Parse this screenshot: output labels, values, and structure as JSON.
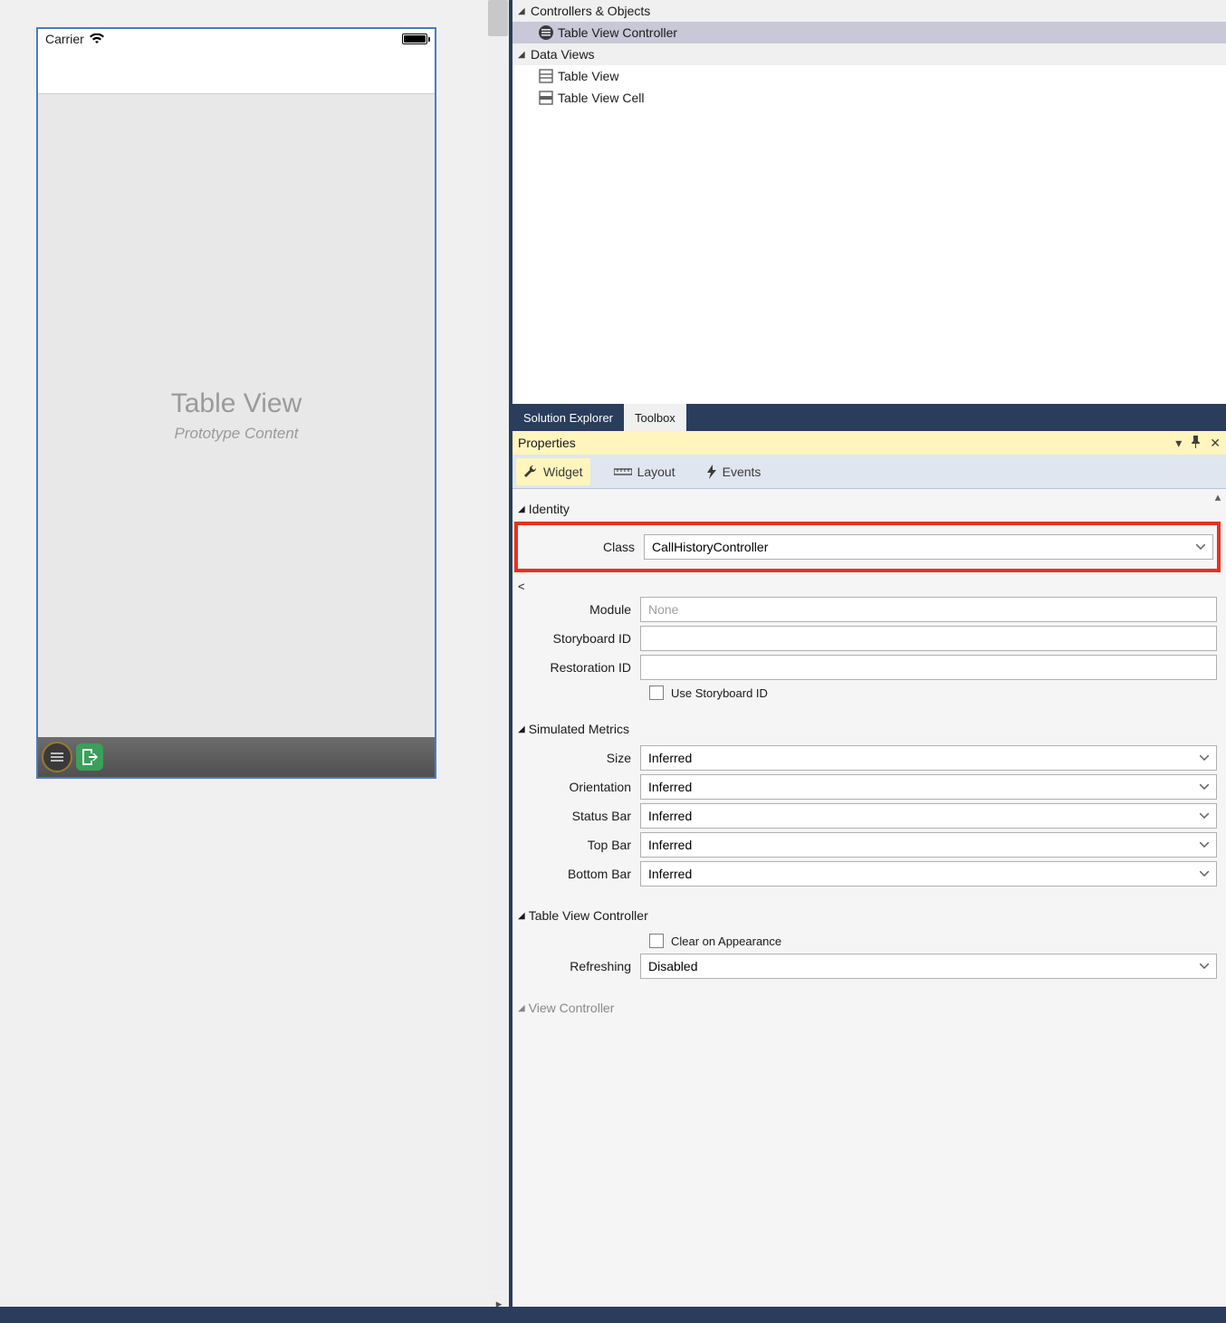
{
  "designer": {
    "carrier": "Carrier",
    "table_title": "Table View",
    "table_sub": "Prototype Content"
  },
  "outline": {
    "section1": "Controllers & Objects",
    "item1": "Table View Controller",
    "section2": "Data Views",
    "item2": "Table View",
    "item3": "Table View Cell"
  },
  "panel_tabs": {
    "solution_explorer": "Solution Explorer",
    "toolbox": "Toolbox"
  },
  "properties": {
    "header": "Properties",
    "tabs": {
      "widget": "Widget",
      "layout": "Layout",
      "events": "Events"
    },
    "identity": {
      "heading": "Identity",
      "class_label": "Class",
      "class_value": "CallHistoryController",
      "module_label": "Module",
      "module_placeholder": "None",
      "storyboard_label": "Storyboard ID",
      "restoration_label": "Restoration ID",
      "use_storyboard": "Use Storyboard ID"
    },
    "simulated": {
      "heading": "Simulated Metrics",
      "size_label": "Size",
      "size_value": "Inferred",
      "orientation_label": "Orientation",
      "orientation_value": "Inferred",
      "statusbar_label": "Status Bar",
      "statusbar_value": "Inferred",
      "topbar_label": "Top Bar",
      "topbar_value": "Inferred",
      "bottombar_label": "Bottom Bar",
      "bottombar_value": "Inferred"
    },
    "tvc": {
      "heading": "Table View Controller",
      "clear": "Clear on Appearance",
      "refreshing_label": "Refreshing",
      "refreshing_value": "Disabled"
    },
    "vc": {
      "heading": "View Controller"
    }
  }
}
